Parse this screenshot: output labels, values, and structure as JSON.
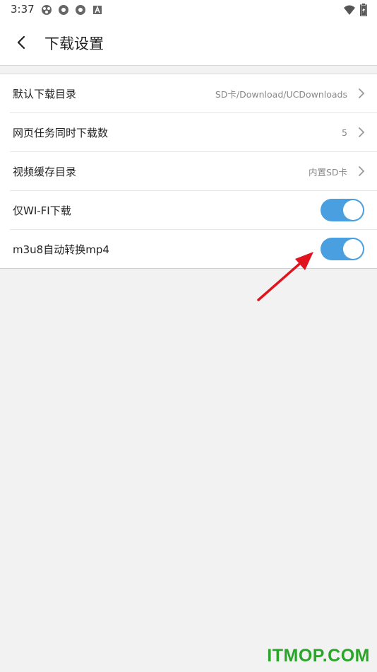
{
  "status_bar": {
    "time": "3:37"
  },
  "header": {
    "title": "下载设置"
  },
  "settings": [
    {
      "label": "默认下载目录",
      "value": "SD卡/Download/UCDownloads",
      "type": "link"
    },
    {
      "label": "网页任务同时下载数",
      "value": "5",
      "type": "link"
    },
    {
      "label": "视频缓存目录",
      "value": "内置SD卡",
      "type": "link"
    },
    {
      "label": "仅WI-FI下载",
      "type": "toggle",
      "on": true
    },
    {
      "label": "m3u8自动转换mp4",
      "type": "toggle",
      "on": true
    }
  ],
  "watermark": "ITMOP.COM",
  "colors": {
    "toggle_on": "#4a9fe0",
    "arrow": "#e0141e",
    "watermark": "#2aa52a"
  }
}
